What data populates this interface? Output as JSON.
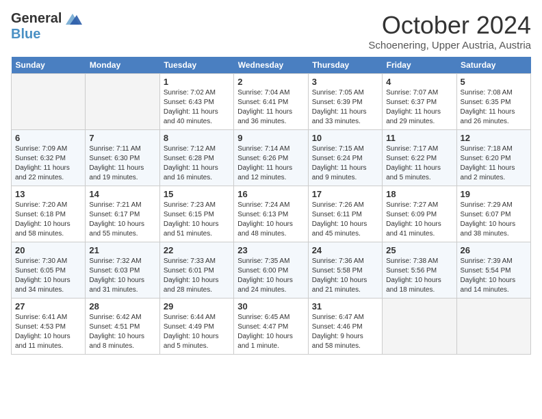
{
  "header": {
    "logo_general": "General",
    "logo_blue": "Blue",
    "month_title": "October 2024",
    "location": "Schoenering, Upper Austria, Austria"
  },
  "columns": [
    "Sunday",
    "Monday",
    "Tuesday",
    "Wednesday",
    "Thursday",
    "Friday",
    "Saturday"
  ],
  "weeks": [
    [
      {
        "day": "",
        "info": ""
      },
      {
        "day": "",
        "info": ""
      },
      {
        "day": "1",
        "info": "Sunrise: 7:02 AM\nSunset: 6:43 PM\nDaylight: 11 hours\nand 40 minutes."
      },
      {
        "day": "2",
        "info": "Sunrise: 7:04 AM\nSunset: 6:41 PM\nDaylight: 11 hours\nand 36 minutes."
      },
      {
        "day": "3",
        "info": "Sunrise: 7:05 AM\nSunset: 6:39 PM\nDaylight: 11 hours\nand 33 minutes."
      },
      {
        "day": "4",
        "info": "Sunrise: 7:07 AM\nSunset: 6:37 PM\nDaylight: 11 hours\nand 29 minutes."
      },
      {
        "day": "5",
        "info": "Sunrise: 7:08 AM\nSunset: 6:35 PM\nDaylight: 11 hours\nand 26 minutes."
      }
    ],
    [
      {
        "day": "6",
        "info": "Sunrise: 7:09 AM\nSunset: 6:32 PM\nDaylight: 11 hours\nand 22 minutes."
      },
      {
        "day": "7",
        "info": "Sunrise: 7:11 AM\nSunset: 6:30 PM\nDaylight: 11 hours\nand 19 minutes."
      },
      {
        "day": "8",
        "info": "Sunrise: 7:12 AM\nSunset: 6:28 PM\nDaylight: 11 hours\nand 16 minutes."
      },
      {
        "day": "9",
        "info": "Sunrise: 7:14 AM\nSunset: 6:26 PM\nDaylight: 11 hours\nand 12 minutes."
      },
      {
        "day": "10",
        "info": "Sunrise: 7:15 AM\nSunset: 6:24 PM\nDaylight: 11 hours\nand 9 minutes."
      },
      {
        "day": "11",
        "info": "Sunrise: 7:17 AM\nSunset: 6:22 PM\nDaylight: 11 hours\nand 5 minutes."
      },
      {
        "day": "12",
        "info": "Sunrise: 7:18 AM\nSunset: 6:20 PM\nDaylight: 11 hours\nand 2 minutes."
      }
    ],
    [
      {
        "day": "13",
        "info": "Sunrise: 7:20 AM\nSunset: 6:18 PM\nDaylight: 10 hours\nand 58 minutes."
      },
      {
        "day": "14",
        "info": "Sunrise: 7:21 AM\nSunset: 6:17 PM\nDaylight: 10 hours\nand 55 minutes."
      },
      {
        "day": "15",
        "info": "Sunrise: 7:23 AM\nSunset: 6:15 PM\nDaylight: 10 hours\nand 51 minutes."
      },
      {
        "day": "16",
        "info": "Sunrise: 7:24 AM\nSunset: 6:13 PM\nDaylight: 10 hours\nand 48 minutes."
      },
      {
        "day": "17",
        "info": "Sunrise: 7:26 AM\nSunset: 6:11 PM\nDaylight: 10 hours\nand 45 minutes."
      },
      {
        "day": "18",
        "info": "Sunrise: 7:27 AM\nSunset: 6:09 PM\nDaylight: 10 hours\nand 41 minutes."
      },
      {
        "day": "19",
        "info": "Sunrise: 7:29 AM\nSunset: 6:07 PM\nDaylight: 10 hours\nand 38 minutes."
      }
    ],
    [
      {
        "day": "20",
        "info": "Sunrise: 7:30 AM\nSunset: 6:05 PM\nDaylight: 10 hours\nand 34 minutes."
      },
      {
        "day": "21",
        "info": "Sunrise: 7:32 AM\nSunset: 6:03 PM\nDaylight: 10 hours\nand 31 minutes."
      },
      {
        "day": "22",
        "info": "Sunrise: 7:33 AM\nSunset: 6:01 PM\nDaylight: 10 hours\nand 28 minutes."
      },
      {
        "day": "23",
        "info": "Sunrise: 7:35 AM\nSunset: 6:00 PM\nDaylight: 10 hours\nand 24 minutes."
      },
      {
        "day": "24",
        "info": "Sunrise: 7:36 AM\nSunset: 5:58 PM\nDaylight: 10 hours\nand 21 minutes."
      },
      {
        "day": "25",
        "info": "Sunrise: 7:38 AM\nSunset: 5:56 PM\nDaylight: 10 hours\nand 18 minutes."
      },
      {
        "day": "26",
        "info": "Sunrise: 7:39 AM\nSunset: 5:54 PM\nDaylight: 10 hours\nand 14 minutes."
      }
    ],
    [
      {
        "day": "27",
        "info": "Sunrise: 6:41 AM\nSunset: 4:53 PM\nDaylight: 10 hours\nand 11 minutes."
      },
      {
        "day": "28",
        "info": "Sunrise: 6:42 AM\nSunset: 4:51 PM\nDaylight: 10 hours\nand 8 minutes."
      },
      {
        "day": "29",
        "info": "Sunrise: 6:44 AM\nSunset: 4:49 PM\nDaylight: 10 hours\nand 5 minutes."
      },
      {
        "day": "30",
        "info": "Sunrise: 6:45 AM\nSunset: 4:47 PM\nDaylight: 10 hours\nand 1 minute."
      },
      {
        "day": "31",
        "info": "Sunrise: 6:47 AM\nSunset: 4:46 PM\nDaylight: 9 hours\nand 58 minutes."
      },
      {
        "day": "",
        "info": ""
      },
      {
        "day": "",
        "info": ""
      }
    ]
  ]
}
